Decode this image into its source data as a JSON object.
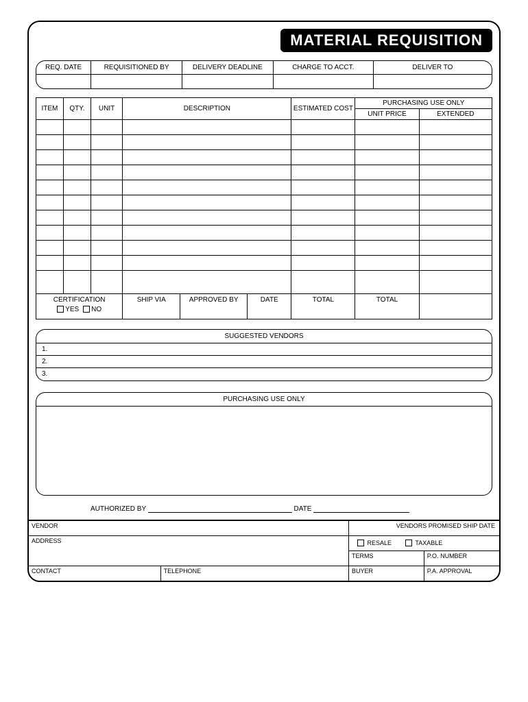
{
  "title": "MATERIAL REQUISITION",
  "header": {
    "req_date": "REQ. DATE",
    "requisitioned_by": "REQUISITIONED BY",
    "delivery_deadline": "DELIVERY DEADLINE",
    "charge_to_acct": "CHARGE TO ACCT.",
    "deliver_to": "DELIVER TO"
  },
  "items_header": {
    "item": "ITEM",
    "qty": "QTY.",
    "unit": "UNIT",
    "description": "DESCRIPTION",
    "est_cost": "ESTIMATED COST",
    "purch_only": "PURCHASING USE ONLY",
    "unit_price": "UNIT PRICE",
    "extended": "EXTENDED"
  },
  "items_footer": {
    "certification": "CERTIFICATION",
    "yes": "YES",
    "no": "NO",
    "ship_via": "SHIP VIA",
    "approved_by": "APPROVED BY",
    "date": "DATE",
    "total1": "TOTAL",
    "total2": "TOTAL"
  },
  "vendors": {
    "title": "SUGGESTED VENDORS",
    "rows": [
      "1.",
      "2.",
      "3."
    ]
  },
  "purchasing_box": {
    "title": "PURCHASING USE ONLY"
  },
  "auth": {
    "authorized_by": "AUTHORIZED BY",
    "date": "DATE"
  },
  "bottom": {
    "vendor": "VENDOR",
    "promised_ship_date": "VENDORS PROMISED SHIP DATE",
    "address": "ADDRESS",
    "resale": "RESALE",
    "taxable": "TAXABLE",
    "terms": "TERMS",
    "po_number": "P.O. NUMBER",
    "contact": "CONTACT",
    "telephone": "TELEPHONE",
    "buyer": "BUYER",
    "pa_approval": "P.A. APPROVAL"
  }
}
